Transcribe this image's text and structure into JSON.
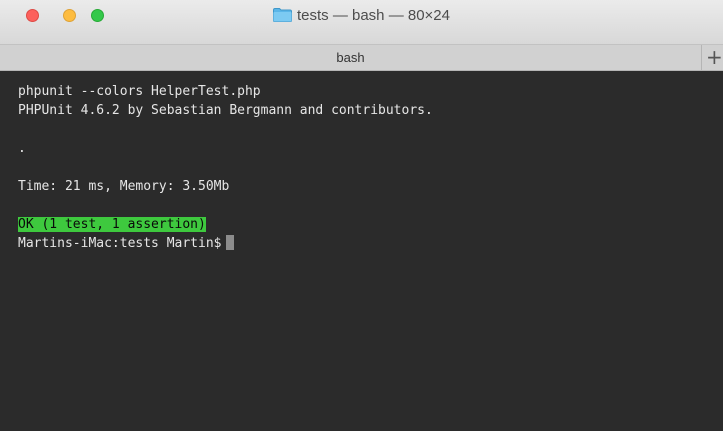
{
  "window": {
    "title": "tests — bash — 80×24",
    "folder_icon": "folder-icon",
    "colors": {
      "close": "#fc605c",
      "minimize": "#fdbc40",
      "zoom": "#34c84a",
      "terminal_bg": "#2b2b2b",
      "ok_highlight": "#3ec93e"
    }
  },
  "tabs": [
    {
      "label": "bash"
    }
  ],
  "new_tab_label": "+",
  "terminal": {
    "lines": [
      {
        "text": "phpunit --colors HelperTest.php"
      },
      {
        "text": "PHPUnit 4.6.2 by Sebastian Bergmann and contributors."
      },
      {
        "text": ""
      },
      {
        "text": "."
      },
      {
        "text": ""
      },
      {
        "text": "Time: 21 ms, Memory: 3.50Mb"
      },
      {
        "text": ""
      },
      {
        "text": "OK (1 test, 1 assertion)"
      },
      {
        "text": "Martins-iMac:tests Martin$"
      }
    ]
  }
}
